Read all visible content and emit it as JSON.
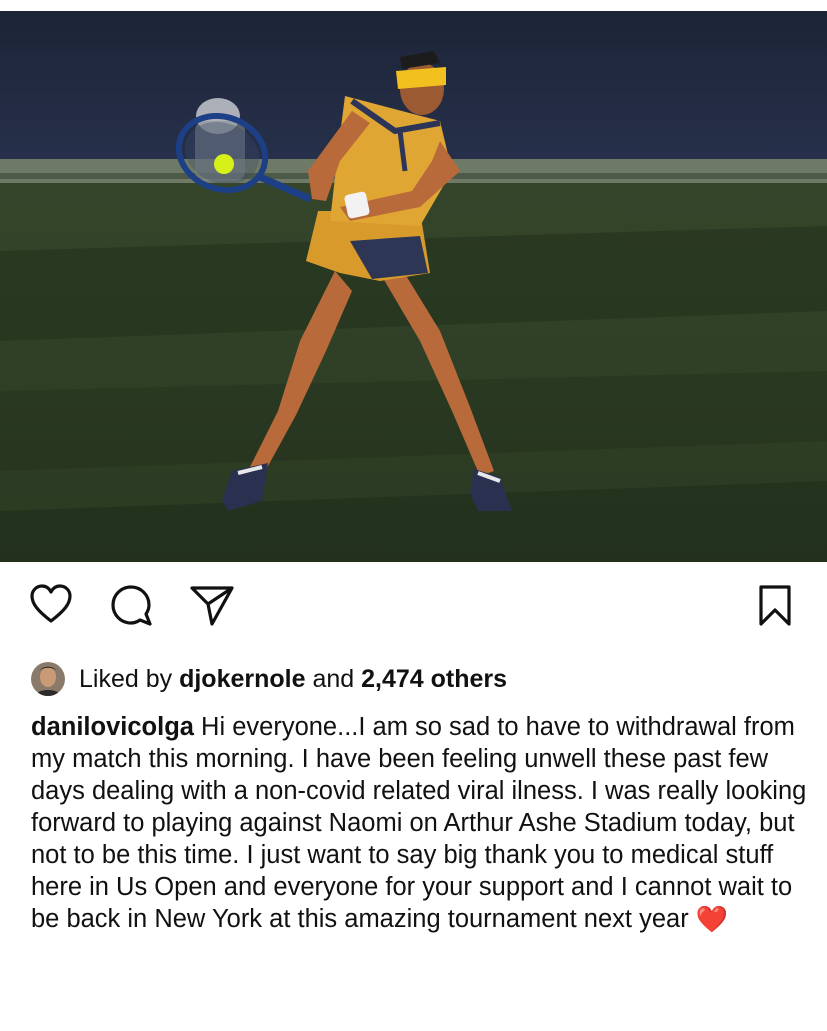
{
  "post": {
    "image_alt": "Tennis player in yellow outfit hitting a backhand on a green court",
    "actions": {
      "like_icon": "heart-outline-icon",
      "comment_icon": "comment-bubble-icon",
      "share_icon": "paper-plane-icon",
      "save_icon": "bookmark-outline-icon"
    },
    "likes": {
      "prefix": "Liked by",
      "user": "djokernole",
      "conjunction": "and",
      "count": "2,474 others"
    },
    "caption": {
      "username": "danilovicolga",
      "text": "Hi everyone...I am so sad to have to withdrawal from my match this morning. I have been feeling unwell these past few days dealing with a non-covid related viral ilness. I was really looking forward to playing against Naomi on Arthur Ashe Stadium today, but not to be this time. I just want to say big thank you to medical stuff here in Us Open and everyone for your support and I cannot wait to be back in New York at this amazing tournament next year",
      "emoji": "❤️"
    }
  }
}
